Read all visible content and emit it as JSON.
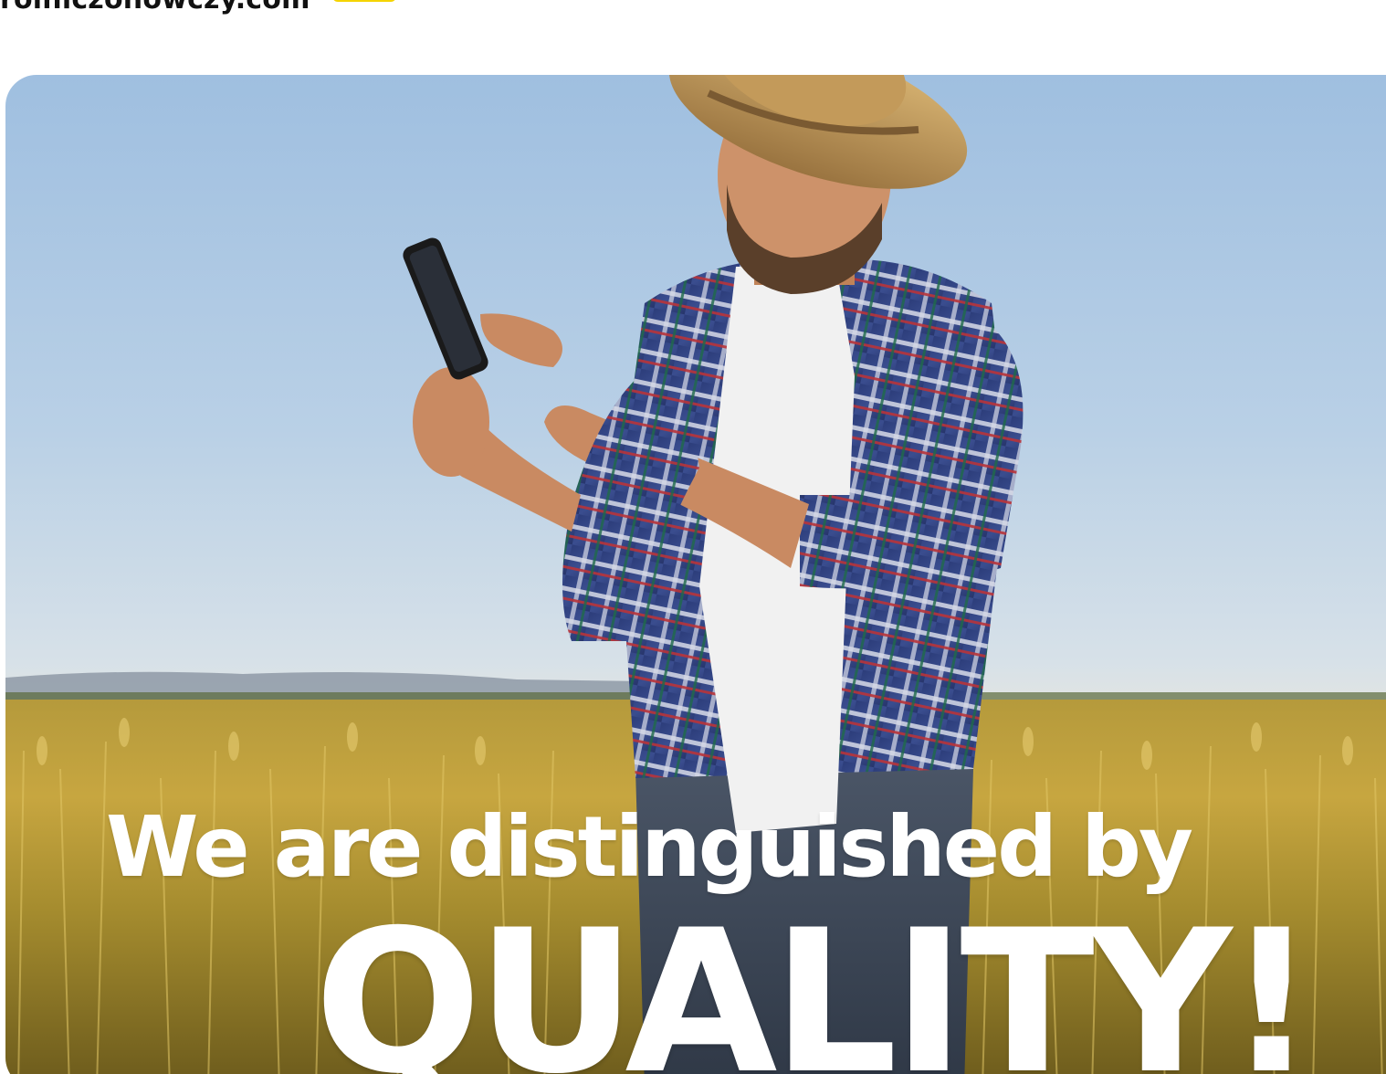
{
  "header": {
    "site_domain": "rolniczohowczy.com"
  },
  "hero": {
    "headline": "We are distinguished by",
    "headline_emphasis": "QUALITY!",
    "image_subject": "farmer-with-phone-in-wheat-field"
  },
  "colors": {
    "accent_yellow": "#f5d400",
    "headline_white": "#ffffff",
    "sky_blue": "#9fbfe0",
    "wheat_gold": "#c9a63a"
  }
}
